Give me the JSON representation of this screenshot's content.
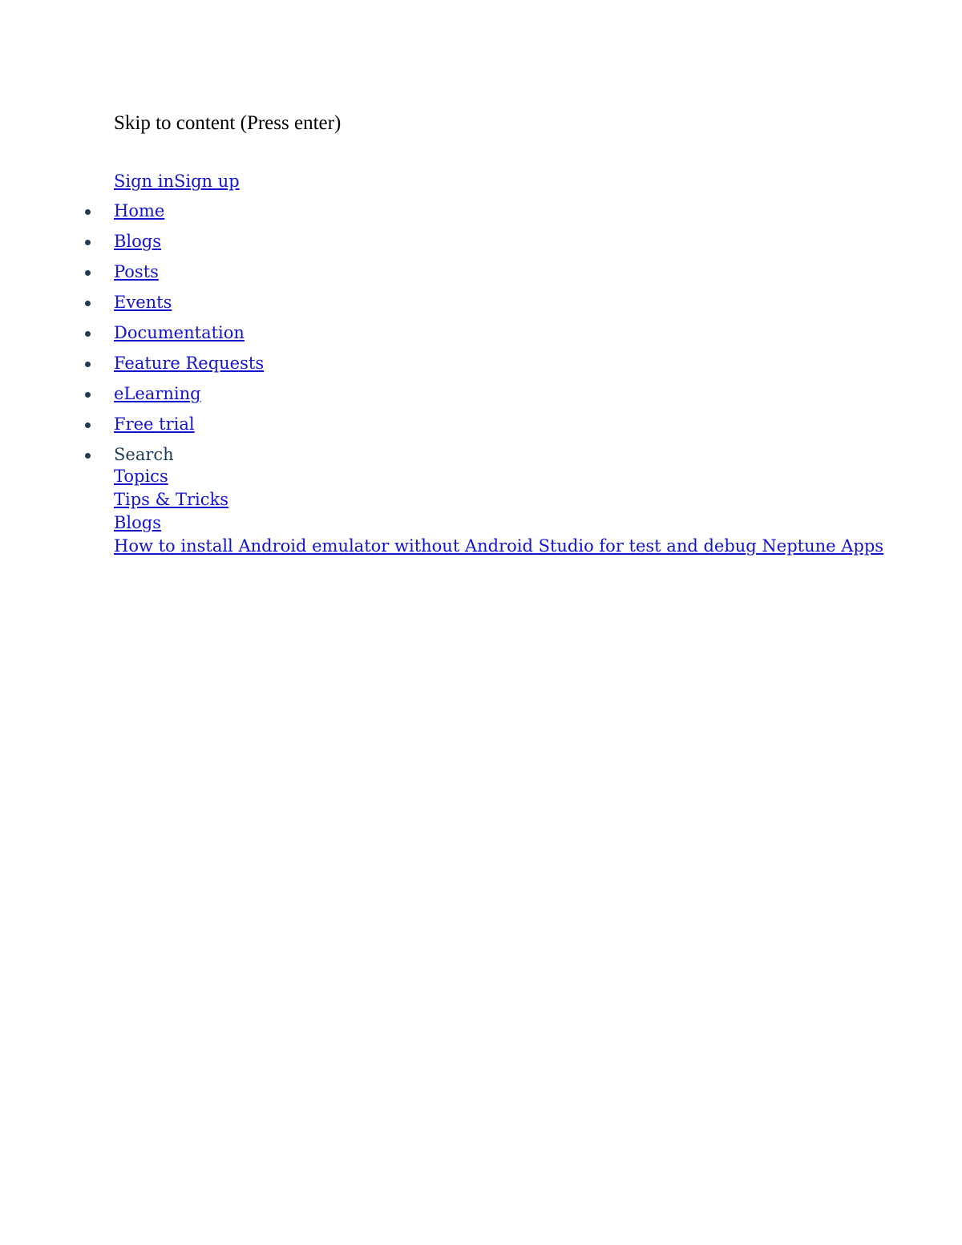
{
  "document": {
    "background_color": "#ffffff",
    "link_color": "#1414CC",
    "text_color": "#000000",
    "muted_text_color": "#1F3A52",
    "bullet_color": "#1F3A52"
  },
  "skip_link": {
    "label": "Skip to content (Press enter)"
  },
  "account": {
    "sign_in_label": "Sign in",
    "sign_up_label": "Sign up"
  },
  "nav": {
    "items": [
      {
        "label": "Home",
        "is_link": true
      },
      {
        "label": "Blogs",
        "is_link": true
      },
      {
        "label": "Posts",
        "is_link": true
      },
      {
        "label": "Events",
        "is_link": true
      },
      {
        "label": "Documentation",
        "is_link": true
      },
      {
        "label": "Feature Requests",
        "is_link": true
      },
      {
        "label": "eLearning",
        "is_link": true
      },
      {
        "label": "Free trial",
        "is_link": true
      }
    ]
  },
  "search_section": {
    "label": "Search",
    "links": [
      {
        "label": "Topics"
      },
      {
        "label": "Tips & Tricks"
      },
      {
        "label": "Blogs"
      },
      {
        "label": "How to install Android emulator without Android Studio for test and debug Neptune Apps"
      }
    ]
  }
}
